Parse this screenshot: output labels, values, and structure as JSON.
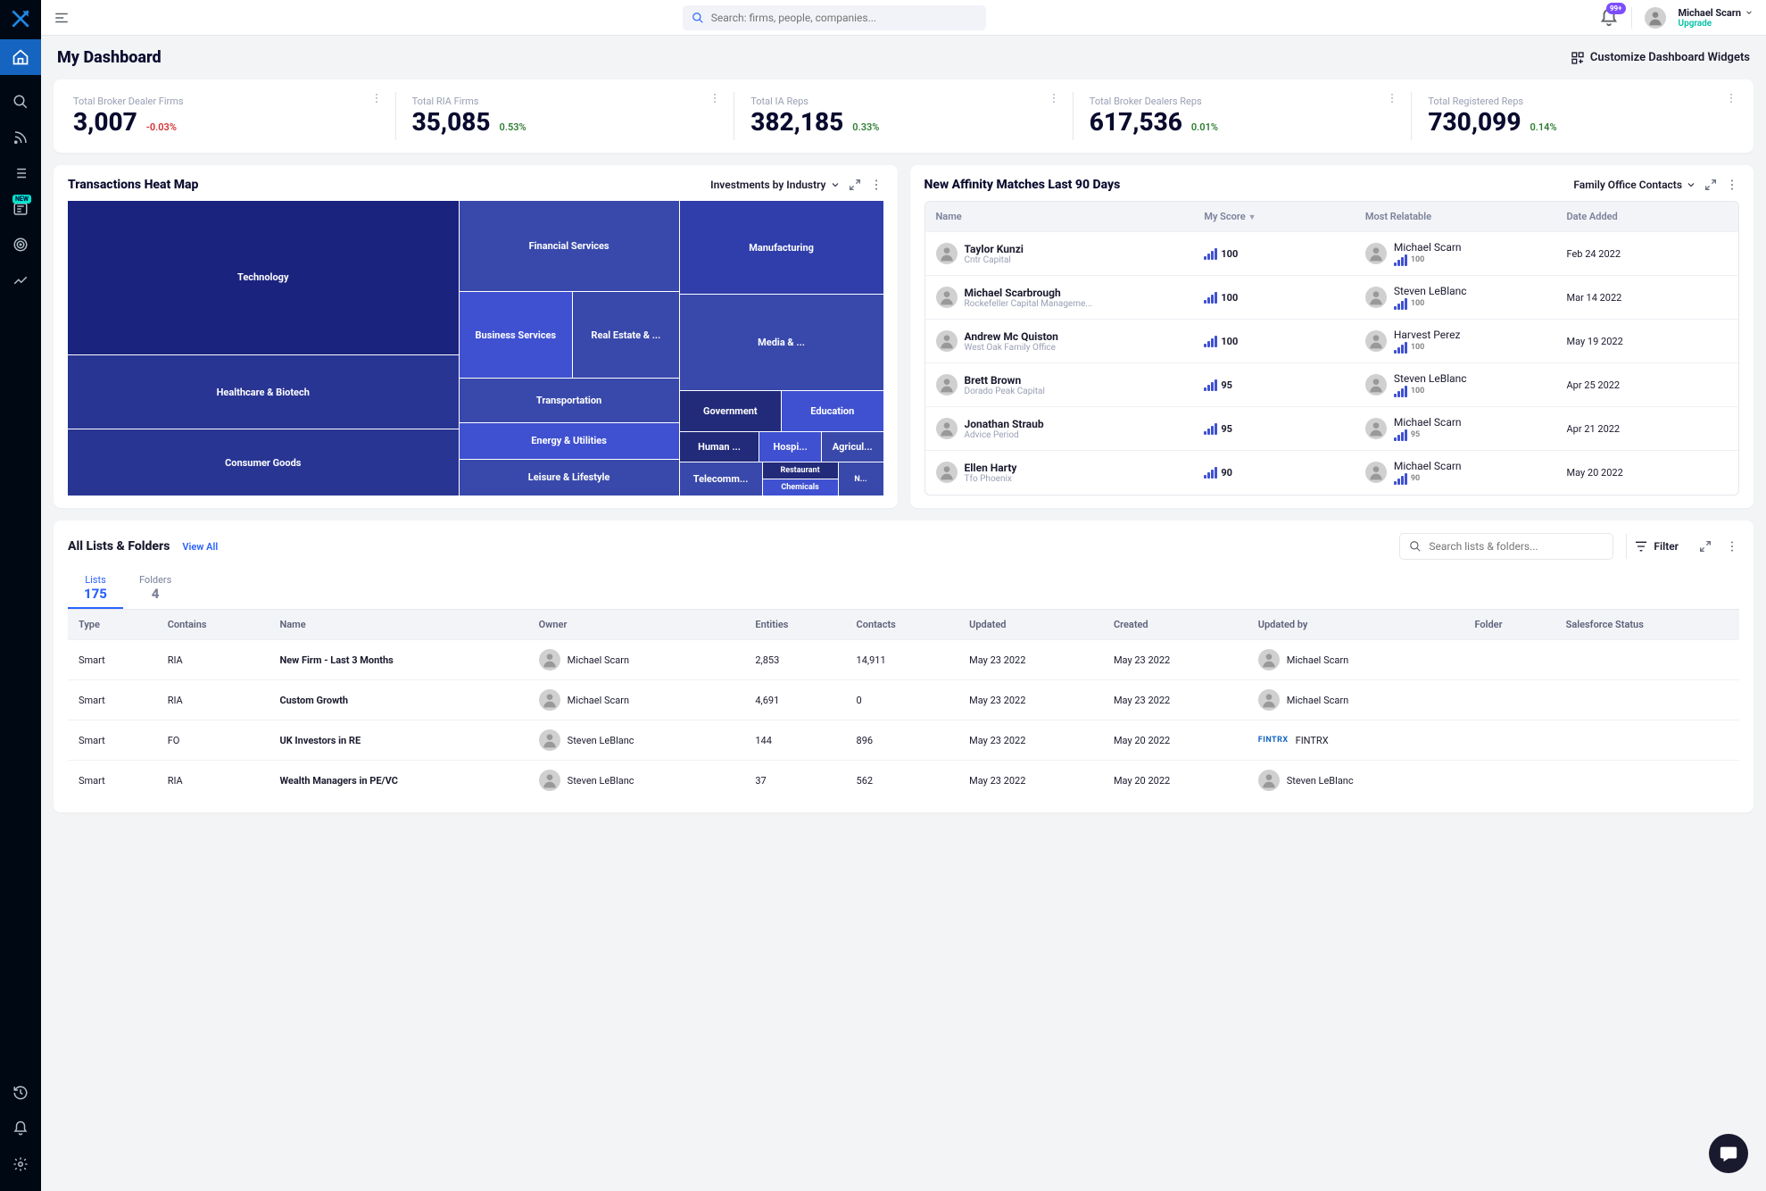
{
  "topbar": {
    "search_placeholder": "Search: firms, people, companies...",
    "notif_badge": "99+",
    "user_name": "Michael Scarn",
    "upgrade": "Upgrade"
  },
  "page_title": "My Dashboard",
  "customize_label": "Customize Dashboard Widgets",
  "stats": [
    {
      "label": "Total Broker Dealer Firms",
      "value": "3,007",
      "delta": "-0.03%",
      "dir": "down"
    },
    {
      "label": "Total RIA Firms",
      "value": "35,085",
      "delta": "0.53%",
      "dir": "up"
    },
    {
      "label": "Total IA Reps",
      "value": "382,185",
      "delta": "0.33%",
      "dir": "up"
    },
    {
      "label": "Total Broker Dealers Reps",
      "value": "617,536",
      "delta": "0.01%",
      "dir": "up"
    },
    {
      "label": "Total Registered Reps",
      "value": "730,099",
      "delta": "0.14%",
      "dir": "up"
    }
  ],
  "heatmap": {
    "title": "Transactions Heat Map",
    "dropdown": "Investments by Industry"
  },
  "chart_data": {
    "type": "treemap",
    "title": "Transactions Heat Map — Investments by Industry",
    "categories": [
      {
        "name": "Technology",
        "value": 180
      },
      {
        "name": "Healthcare & Biotech",
        "value": 80
      },
      {
        "name": "Consumer Goods",
        "value": 70
      },
      {
        "name": "Financial Services",
        "value": 55
      },
      {
        "name": "Manufacturing",
        "value": 40
      },
      {
        "name": "Business Services",
        "value": 50
      },
      {
        "name": "Real Estate & ...",
        "value": 35
      },
      {
        "name": "Media & ...",
        "value": 30
      },
      {
        "name": "Transportation",
        "value": 25
      },
      {
        "name": "Energy & Utilities",
        "value": 25
      },
      {
        "name": "Leisure & Lifestyle",
        "value": 25
      },
      {
        "name": "Government",
        "value": 18
      },
      {
        "name": "Education",
        "value": 16
      },
      {
        "name": "Human ...",
        "value": 14
      },
      {
        "name": "Telecomm...",
        "value": 12
      },
      {
        "name": "Hospi...",
        "value": 10
      },
      {
        "name": "Agricul...",
        "value": 10
      },
      {
        "name": "Restaurant",
        "value": 8
      },
      {
        "name": "Chemicals",
        "value": 6
      },
      {
        "name": "N...",
        "value": 4
      }
    ]
  },
  "affinity": {
    "title": "New Affinity Matches Last 90 Days",
    "dropdown": "Family Office Contacts",
    "columns": {
      "name": "Name",
      "score": "My Score",
      "relatable": "Most Relatable",
      "date": "Date Added"
    },
    "rows": [
      {
        "name": "Taylor Kunzi",
        "sub": "Cntr Capital",
        "score": "100",
        "rel": "Michael Scarn",
        "rel_score": "100",
        "date": "Feb 24 2022"
      },
      {
        "name": "Michael Scarbrough",
        "sub": "Rockefeller Capital Manageme...",
        "score": "100",
        "rel": "Steven LeBlanc",
        "rel_score": "100",
        "date": "Mar 14 2022"
      },
      {
        "name": "Andrew Mc Quiston",
        "sub": "West Oak Family Office",
        "score": "100",
        "rel": "Harvest Perez",
        "rel_score": "100",
        "date": "May 19 2022"
      },
      {
        "name": "Brett Brown",
        "sub": "Dorado Peak Capital",
        "score": "95",
        "rel": "Steven LeBlanc",
        "rel_score": "100",
        "date": "Apr 25 2022"
      },
      {
        "name": "Jonathan Straub",
        "sub": "Advice Period",
        "score": "95",
        "rel": "Michael Scarn",
        "rel_score": "95",
        "date": "Apr 21 2022"
      },
      {
        "name": "Ellen Harty",
        "sub": "Tfo Phoenix",
        "score": "90",
        "rel": "Michael Scarn",
        "rel_score": "90",
        "date": "May 20 2022"
      }
    ]
  },
  "lists": {
    "title": "All Lists & Folders",
    "view_all": "View All",
    "search_placeholder": "Search lists & folders...",
    "filter_label": "Filter",
    "tabs": {
      "lists_label": "Lists",
      "lists_count": "175",
      "folders_label": "Folders",
      "folders_count": "4"
    },
    "columns": {
      "type": "Type",
      "contains": "Contains",
      "name": "Name",
      "owner": "Owner",
      "entities": "Entities",
      "contacts": "Contacts",
      "updated": "Updated",
      "created": "Created",
      "updated_by": "Updated by",
      "folder": "Folder",
      "sf": "Salesforce Status"
    },
    "rows": [
      {
        "type": "Smart",
        "contains": "RIA",
        "name": "New Firm - Last 3 Months",
        "owner": "Michael Scarn",
        "entities": "2,853",
        "contacts": "14,911",
        "updated": "May 23 2022",
        "created": "May 23 2022",
        "updated_by": "Michael Scarn",
        "updated_by_logo": ""
      },
      {
        "type": "Smart",
        "contains": "RIA",
        "name": "Custom Growth",
        "owner": "Michael Scarn",
        "entities": "4,691",
        "contacts": "0",
        "updated": "May 23 2022",
        "created": "May 23 2022",
        "updated_by": "Michael Scarn",
        "updated_by_logo": ""
      },
      {
        "type": "Smart",
        "contains": "FO",
        "name": "UK Investors in RE",
        "owner": "Steven LeBlanc",
        "entities": "144",
        "contacts": "896",
        "updated": "May 23 2022",
        "created": "May 20 2022",
        "updated_by": "FINTRX",
        "updated_by_logo": "fintrx"
      },
      {
        "type": "Smart",
        "contains": "RIA",
        "name": "Wealth Managers in PE/VC",
        "owner": "Steven LeBlanc",
        "entities": "37",
        "contacts": "562",
        "updated": "May 23 2022",
        "created": "May 20 2022",
        "updated_by": "Steven LeBlanc",
        "updated_by_logo": ""
      }
    ]
  }
}
